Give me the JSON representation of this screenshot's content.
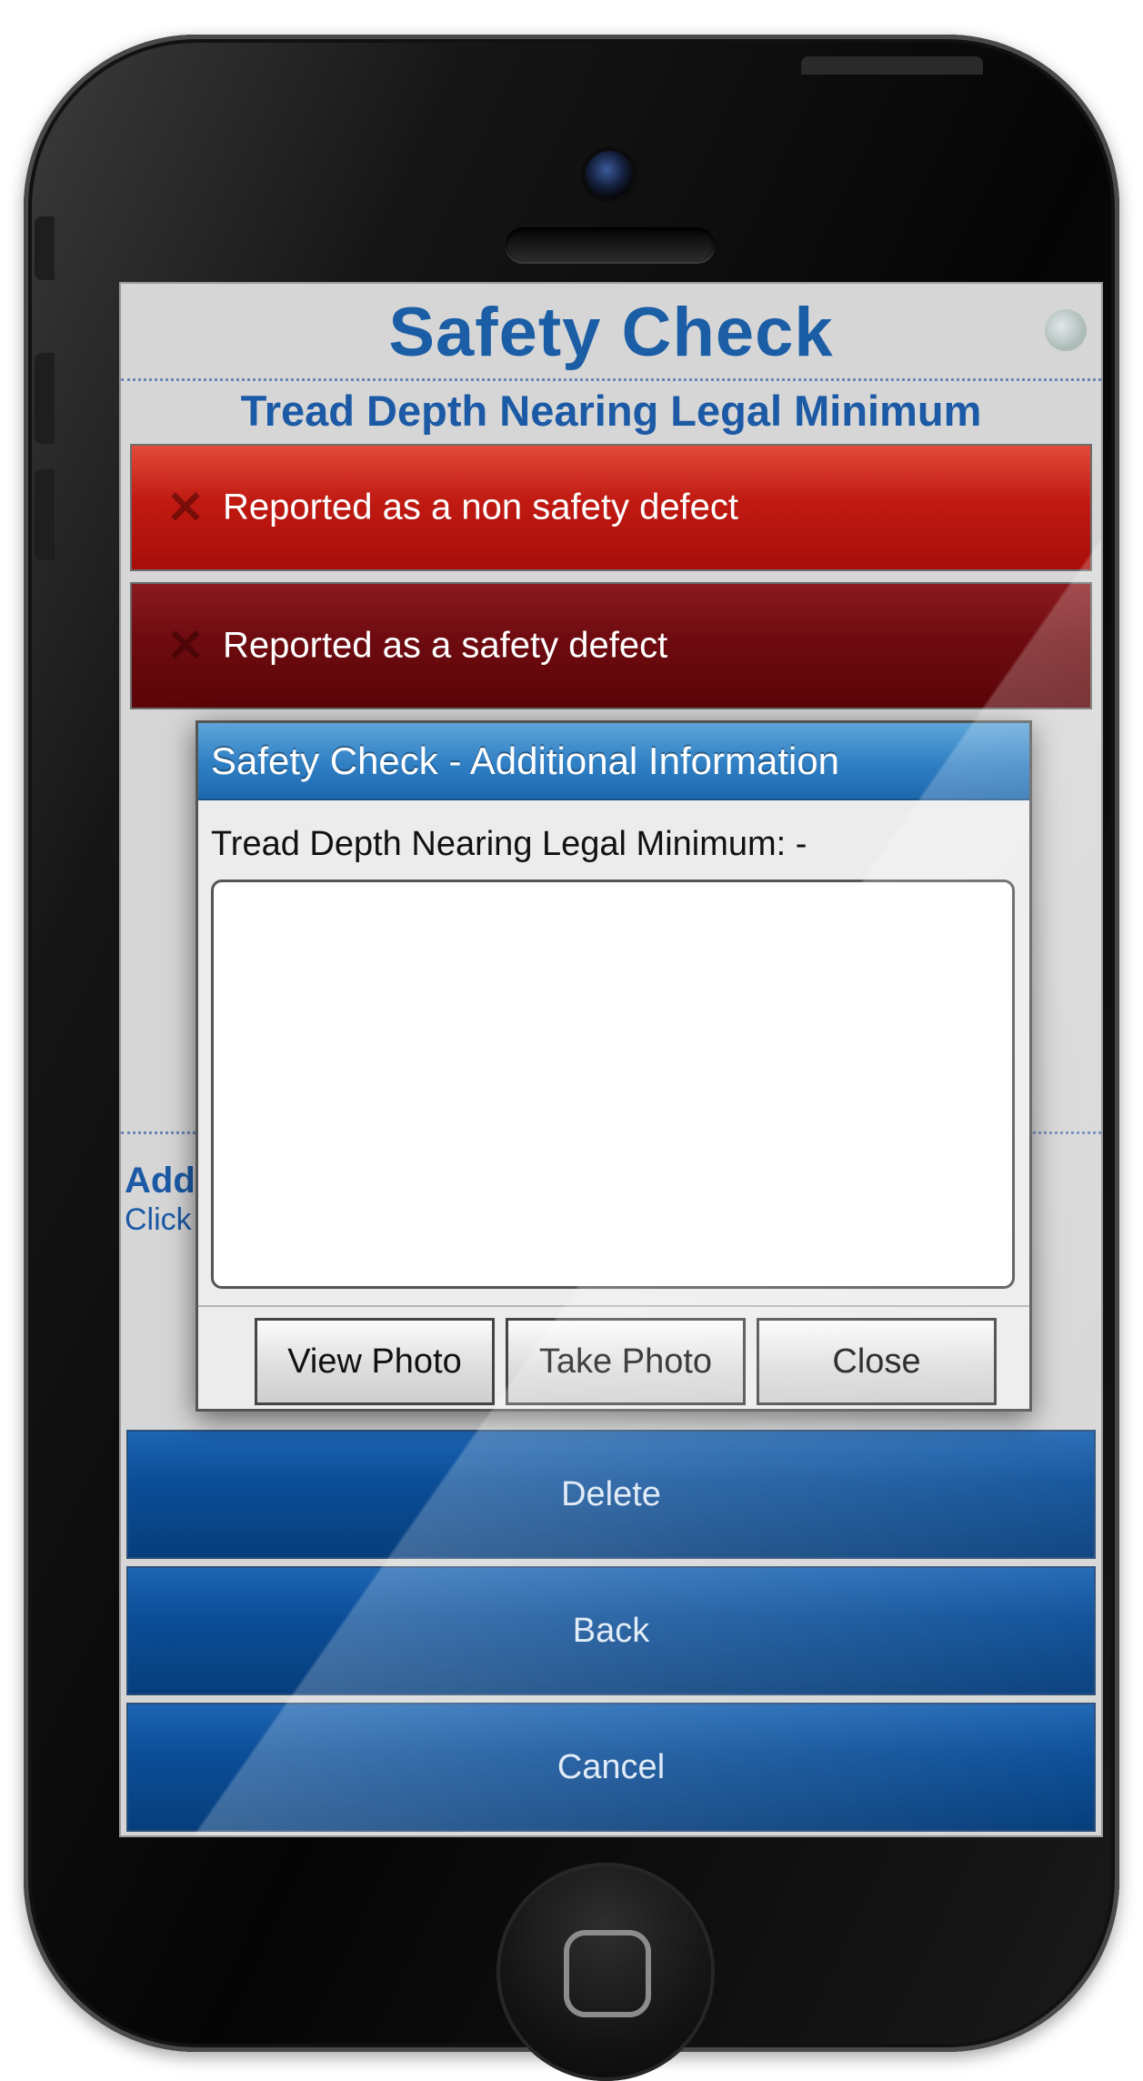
{
  "app": {
    "title": "Safety Check",
    "subtitle": "Tread Depth Nearing Legal Minimum"
  },
  "options": [
    {
      "label": "Reported as a non safety defect"
    },
    {
      "label": "Reported as a safety defect"
    }
  ],
  "background_section": {
    "heading_visible": "Add",
    "text_visible": "Click"
  },
  "actions": [
    {
      "label": "Delete"
    },
    {
      "label": "Back"
    },
    {
      "label": "Cancel"
    }
  ],
  "modal": {
    "title": "Safety Check - Additional Information",
    "field_label": "Tread Depth Nearing Legal Minimum: -",
    "textarea_value": "",
    "buttons": {
      "view_photo": "View Photo",
      "take_photo": "Take Photo",
      "close": "Close"
    }
  },
  "colors": {
    "title_blue": "#1b5ea6",
    "non_safety_red": "#c01a12",
    "safety_maroon": "#6e0b10",
    "action_blue": "#0b4e98",
    "modal_header_blue": "#2f7fc4"
  }
}
